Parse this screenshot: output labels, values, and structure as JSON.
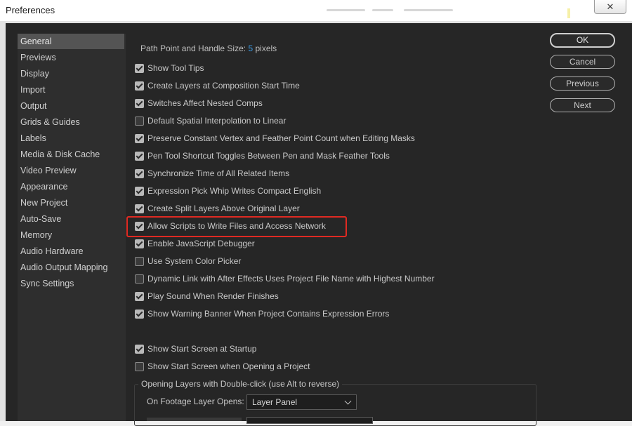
{
  "window": {
    "title": "Preferences",
    "close_glyph": "✕"
  },
  "sidebar": {
    "items": [
      {
        "label": "General",
        "selected": true
      },
      {
        "label": "Previews"
      },
      {
        "label": "Display"
      },
      {
        "label": "Import"
      },
      {
        "label": "Output"
      },
      {
        "label": "Grids & Guides"
      },
      {
        "label": "Labels"
      },
      {
        "label": "Media & Disk Cache"
      },
      {
        "label": "Video Preview"
      },
      {
        "label": "Appearance"
      },
      {
        "label": "New Project"
      },
      {
        "label": "Auto-Save"
      },
      {
        "label": "Memory"
      },
      {
        "label": "Audio Hardware"
      },
      {
        "label": "Audio Output Mapping"
      },
      {
        "label": "Sync Settings"
      }
    ]
  },
  "general": {
    "path_point_label": "Path Point and Handle Size:",
    "path_point_value": "5",
    "path_point_unit": "pixels",
    "options": [
      {
        "label": "Show Tool Tips",
        "checked": true
      },
      {
        "label": "Create Layers at Composition Start Time",
        "checked": true
      },
      {
        "label": "Switches Affect Nested Comps",
        "checked": true
      },
      {
        "label": "Default Spatial Interpolation to Linear",
        "checked": false
      },
      {
        "label": "Preserve Constant Vertex and Feather Point Count when Editing Masks",
        "checked": true
      },
      {
        "label": "Pen Tool Shortcut Toggles Between Pen and Mask Feather Tools",
        "checked": true
      },
      {
        "label": "Synchronize Time of All Related Items",
        "checked": true
      },
      {
        "label": "Expression Pick Whip Writes Compact English",
        "checked": true
      },
      {
        "label": "Create Split Layers Above Original Layer",
        "checked": true
      },
      {
        "label": "Allow Scripts to Write Files and Access Network",
        "checked": true,
        "highlighted": true
      },
      {
        "label": "Enable JavaScript Debugger",
        "checked": true
      },
      {
        "label": "Use System Color Picker",
        "checked": false
      },
      {
        "label": "Dynamic Link with After Effects Uses Project File Name with Highest Number",
        "checked": false
      },
      {
        "label": "Play Sound When Render Finishes",
        "checked": true
      },
      {
        "label": "Show Warning Banner When Project Contains Expression Errors",
        "checked": true
      }
    ],
    "startup_options": [
      {
        "label": "Show Start Screen at Startup",
        "checked": true
      },
      {
        "label": "Show Start Screen when Opening a Project",
        "checked": false
      }
    ],
    "double_click_group": {
      "legend": "Opening Layers with Double-click (use Alt to reverse)",
      "footage_label": "On Footage Layer Opens:",
      "footage_value": "Layer Panel"
    }
  },
  "buttons": {
    "ok": "OK",
    "cancel": "Cancel",
    "previous": "Previous",
    "next": "Next"
  },
  "colors": {
    "panel_bg": "#262626",
    "accent_value": "#3a96dd",
    "highlight_border": "#e02a22"
  }
}
